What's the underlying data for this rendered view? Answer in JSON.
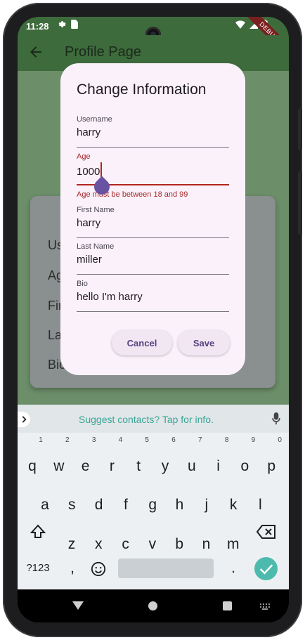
{
  "status": {
    "time": "11:28"
  },
  "debug_banner": "DEBUG",
  "appbar": {
    "title": "Profile Page"
  },
  "background_card": {
    "labels": [
      "Us",
      "Ag",
      "Fir",
      "La",
      "Bio"
    ]
  },
  "dialog": {
    "title": "Change Information",
    "fields": [
      {
        "label": "Username",
        "value": "harry"
      },
      {
        "label": "Age",
        "value": "1000",
        "error": "Age must be between 18 and 99"
      },
      {
        "label": "First Name",
        "value": "harry"
      },
      {
        "label": "Last Name",
        "value": "miller"
      },
      {
        "label": "Bio",
        "value": "hello I'm harry"
      }
    ],
    "cancel_label": "Cancel",
    "save_label": "Save"
  },
  "keyboard": {
    "suggestion": "Suggest contacts? Tap for info.",
    "row1": [
      {
        "k": "q",
        "h": "1"
      },
      {
        "k": "w",
        "h": "2"
      },
      {
        "k": "e",
        "h": "3"
      },
      {
        "k": "r",
        "h": "4"
      },
      {
        "k": "t",
        "h": "5"
      },
      {
        "k": "y",
        "h": "6"
      },
      {
        "k": "u",
        "h": "7"
      },
      {
        "k": "i",
        "h": "8"
      },
      {
        "k": "o",
        "h": "9"
      },
      {
        "k": "p",
        "h": "0"
      }
    ],
    "row2": [
      "a",
      "s",
      "d",
      "f",
      "g",
      "h",
      "j",
      "k",
      "l"
    ],
    "row3": [
      "z",
      "x",
      "c",
      "v",
      "b",
      "n",
      "m"
    ],
    "symbols_label": "?123",
    "comma_label": ",",
    "period_label": "."
  },
  "colors": {
    "appbar": "#3e6b3c",
    "dialog_bg": "#fbf1fa",
    "error": "#b3261e",
    "primary": "#6a52a3",
    "accent": "#4dbaae"
  }
}
